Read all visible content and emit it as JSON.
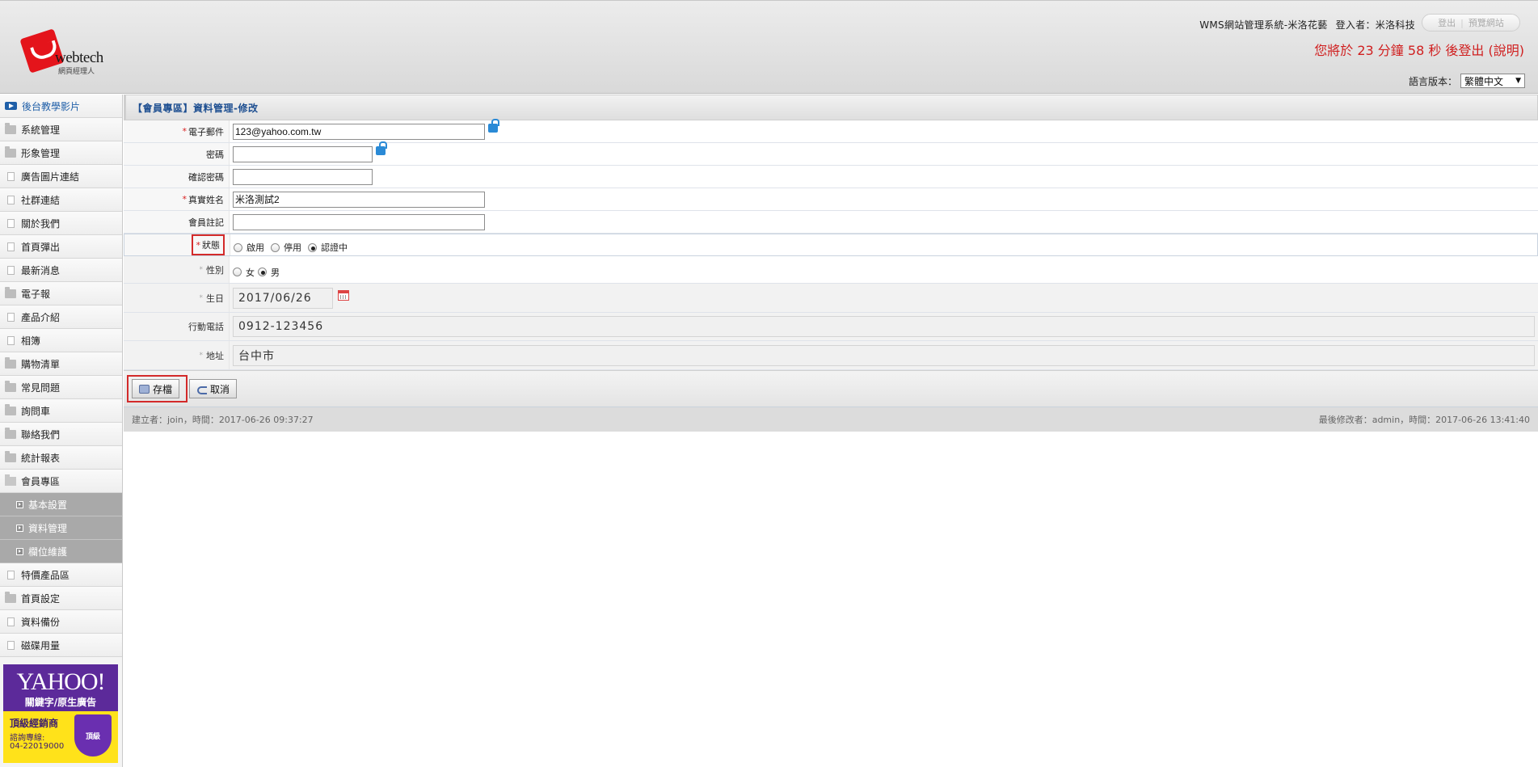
{
  "header": {
    "system_title": "WMS網站管理系統-米洛花藝",
    "login_user": "登入者：米洛科技",
    "logout_label": "登出",
    "preview_label": "預覽網站",
    "countdown": "您將於 23 分鐘 58 秒 後登出 (說明)",
    "lang_label": "語言版本：",
    "lang_value": "繁體中文",
    "logo_word": "webtech",
    "logo_sub": "網頁經理人"
  },
  "sidebar": {
    "items": [
      {
        "label": "後台教學影片",
        "icon": "video-icon"
      },
      {
        "label": "系統管理",
        "icon": "folder-icon"
      },
      {
        "label": "形象管理",
        "icon": "folder-icon"
      },
      {
        "label": "廣告圖片連結",
        "icon": "page-icon"
      },
      {
        "label": "社群連結",
        "icon": "page-icon"
      },
      {
        "label": "關於我們",
        "icon": "page-icon"
      },
      {
        "label": "首頁彈出",
        "icon": "page-icon"
      },
      {
        "label": "最新消息",
        "icon": "page-icon"
      },
      {
        "label": "電子報",
        "icon": "folder-icon"
      },
      {
        "label": "產品介紹",
        "icon": "page-icon"
      },
      {
        "label": "相簿",
        "icon": "page-icon"
      },
      {
        "label": "購物清單",
        "icon": "folder-icon"
      },
      {
        "label": "常見問題",
        "icon": "folder-icon"
      },
      {
        "label": "詢問車",
        "icon": "folder-icon"
      },
      {
        "label": "聯絡我們",
        "icon": "folder-icon"
      },
      {
        "label": "統計報表",
        "icon": "folder-icon"
      },
      {
        "label": "會員專區",
        "icon": "open-folder-icon"
      },
      {
        "label": "基本設置",
        "icon": "arrow-square-icon",
        "sub": true
      },
      {
        "label": "資料管理",
        "icon": "arrow-square-icon",
        "sub": true
      },
      {
        "label": "欄位維護",
        "icon": "arrow-square-icon",
        "sub": true
      },
      {
        "label": "特價產品區",
        "icon": "page-icon"
      },
      {
        "label": "首頁設定",
        "icon": "folder-icon"
      },
      {
        "label": "資料備份",
        "icon": "page-icon"
      },
      {
        "label": "磁碟用量",
        "icon": "page-icon"
      }
    ],
    "ad": {
      "logo": "YAHOO!",
      "keyword": "關鍵字/原生廣告",
      "line1": "頂級經銷商",
      "line2": "諮詢專線:",
      "line3": "04-22019000",
      "badge": "頂級"
    }
  },
  "form": {
    "title": "【會員專區】資料管理-修改",
    "email_label": "電子郵件",
    "email_value": "123@yahoo.com.tw",
    "password_label": "密碼",
    "password_value": "",
    "confirm_label": "確認密碼",
    "confirm_value": "",
    "name_label": "真實姓名",
    "name_value": "米洛測試2",
    "note_label": "會員註記",
    "note_value": "",
    "status_label": "狀態",
    "status_options": [
      "啟用",
      "停用",
      "認證中"
    ],
    "status_selected": 2,
    "gender_label": "性別",
    "gender_options": [
      "女",
      "男"
    ],
    "gender_selected": 1,
    "birthday_label": "生日",
    "birthday_value": "2017/06/26",
    "mobile_label": "行動電話",
    "mobile_value": "0912-123456",
    "address_label": "地址",
    "address_value": "台中市",
    "save_label": "存檔",
    "cancel_label": "取消",
    "created_meta": "建立者：join，時間：2017-06-26 09:37:27",
    "modified_meta": "最後修改者：admin，時間：2017-06-26 13:41:40"
  },
  "colors": {
    "accent_blue": "#1e4f91",
    "warning_red": "#d01f1f",
    "highlight_red": "#d32a2a"
  }
}
